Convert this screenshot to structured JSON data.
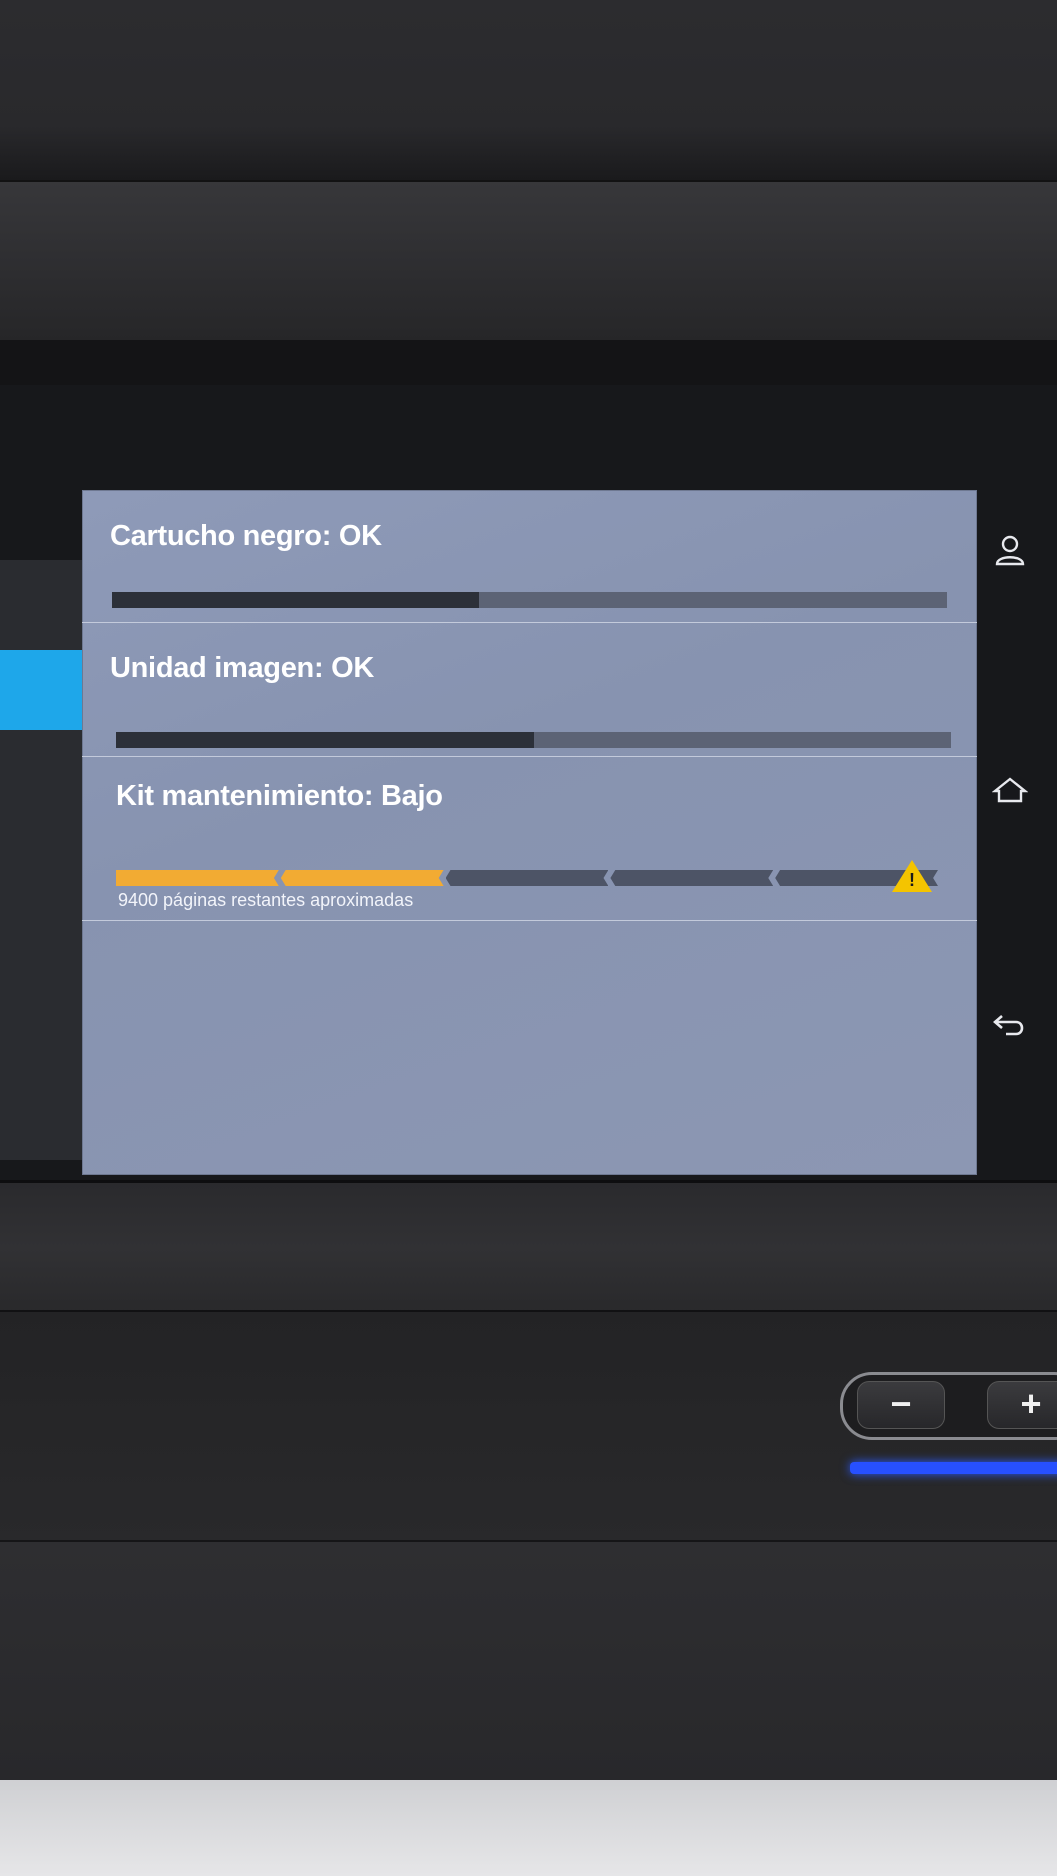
{
  "status_panel": {
    "rows": [
      {
        "title": "Cartucho negro: OK",
        "level_percent": 44
      },
      {
        "title": "Unidad imagen: OK",
        "level_percent": 50
      },
      {
        "title": "Kit mantenimiento: Bajo",
        "segments_total": 5,
        "segments_filled": 2,
        "note": "9400 páginas restantes aproximadas",
        "warning_icon": "warning-triangle-icon"
      }
    ]
  },
  "nav": {
    "icons": [
      "user-icon",
      "home-icon",
      "back-icon"
    ]
  },
  "volume": {
    "minus_label": "−",
    "plus_label": "+"
  },
  "colors": {
    "panel": "#8c97b3",
    "bar_fill": "#2c3039",
    "bar_track": "#5c6375",
    "segment_on": "#f2ab33",
    "segment_off": "#4d5466",
    "warning": "#f4c400",
    "accent": "#1ea7ea",
    "led": "#2750ff"
  }
}
